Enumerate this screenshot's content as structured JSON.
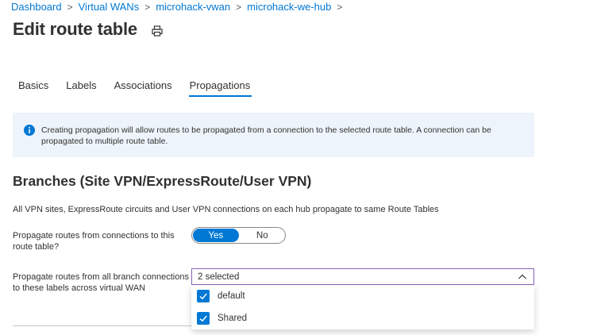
{
  "breadcrumb": {
    "items": [
      "Dashboard",
      "Virtual WANs",
      "microhack-vwan",
      "microhack-we-hub"
    ],
    "separator": ">"
  },
  "page": {
    "title": "Edit route table"
  },
  "tabs": [
    {
      "label": "Basics",
      "active": false
    },
    {
      "label": "Labels",
      "active": false
    },
    {
      "label": "Associations",
      "active": false
    },
    {
      "label": "Propagations",
      "active": true
    }
  ],
  "info": {
    "text": "Creating propagation will allow routes to be propagated from a connection to the selected route table. A connection can be propagated to multiple route table."
  },
  "branches": {
    "title": "Branches (Site VPN/ExpressRoute/User VPN)",
    "description": "All VPN sites, ExpressRoute circuits and User VPN connections on each hub propagate to same Route Tables",
    "propagate_label": "Propagate routes from connections to this route table?",
    "toggle": {
      "yes": "Yes",
      "no": "No",
      "selected": "Yes"
    },
    "labels_label": "Propagate routes from all branch connections to these labels across virtual WAN",
    "select_value": "2 selected",
    "options": [
      {
        "label": "default",
        "checked": true
      },
      {
        "label": "Shared",
        "checked": true
      }
    ]
  },
  "colors": {
    "accent": "#0078d4",
    "info_bg": "#eef4fb",
    "select_border": "#8764b8"
  }
}
